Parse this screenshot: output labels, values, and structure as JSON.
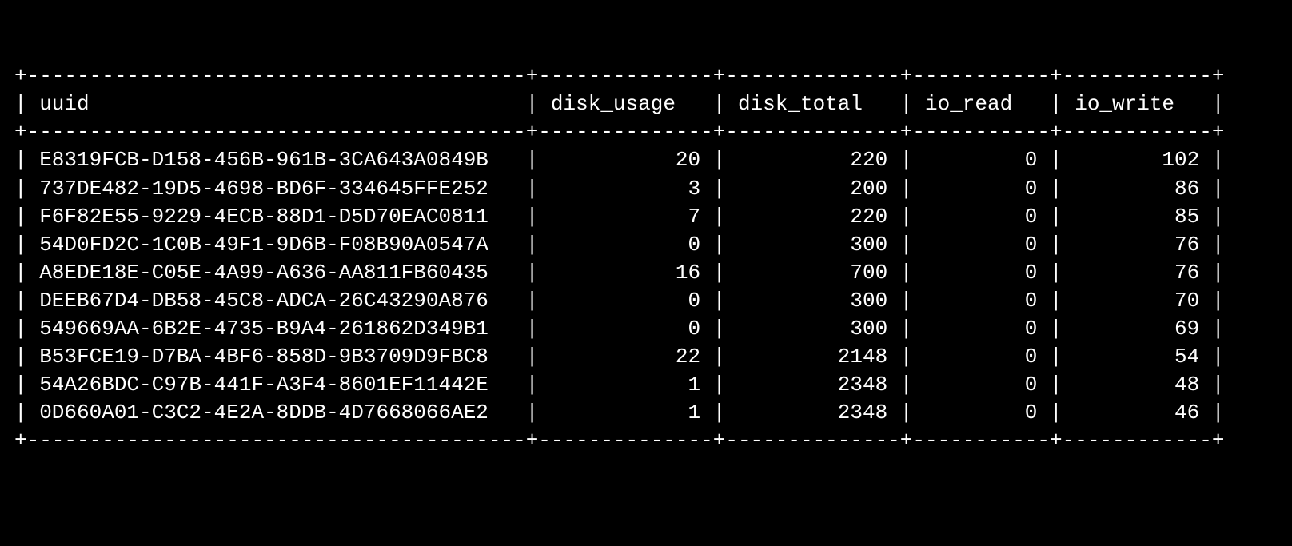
{
  "table": {
    "columns": [
      {
        "name": "uuid",
        "width": 38,
        "align": "left"
      },
      {
        "name": "disk_usage",
        "width": 12,
        "align": "right"
      },
      {
        "name": "disk_total",
        "width": 12,
        "align": "right"
      },
      {
        "name": "io_read",
        "width": 9,
        "align": "right"
      },
      {
        "name": "io_write",
        "width": 10,
        "align": "right"
      }
    ],
    "rows": [
      {
        "uuid": "E8319FCB-D158-456B-961B-3CA643A0849B",
        "disk_usage": "20",
        "disk_total": "220",
        "io_read": "0",
        "io_write": "102"
      },
      {
        "uuid": "737DE482-19D5-4698-BD6F-334645FFE252",
        "disk_usage": "3",
        "disk_total": "200",
        "io_read": "0",
        "io_write": "86"
      },
      {
        "uuid": "F6F82E55-9229-4ECB-88D1-D5D70EAC0811",
        "disk_usage": "7",
        "disk_total": "220",
        "io_read": "0",
        "io_write": "85"
      },
      {
        "uuid": "54D0FD2C-1C0B-49F1-9D6B-F08B90A0547A",
        "disk_usage": "0",
        "disk_total": "300",
        "io_read": "0",
        "io_write": "76"
      },
      {
        "uuid": "A8EDE18E-C05E-4A99-A636-AA811FB60435",
        "disk_usage": "16",
        "disk_total": "700",
        "io_read": "0",
        "io_write": "76"
      },
      {
        "uuid": "DEEB67D4-DB58-45C8-ADCA-26C43290A876",
        "disk_usage": "0",
        "disk_total": "300",
        "io_read": "0",
        "io_write": "70"
      },
      {
        "uuid": "549669AA-6B2E-4735-B9A4-261862D349B1",
        "disk_usage": "0",
        "disk_total": "300",
        "io_read": "0",
        "io_write": "69"
      },
      {
        "uuid": "B53FCE19-D7BA-4BF6-858D-9B3709D9FBC8",
        "disk_usage": "22",
        "disk_total": "2148",
        "io_read": "0",
        "io_write": "54"
      },
      {
        "uuid": "54A26BDC-C97B-441F-A3F4-8601EF11442E",
        "disk_usage": "1",
        "disk_total": "2348",
        "io_read": "0",
        "io_write": "48"
      },
      {
        "uuid": "0D660A01-C3C2-4E2A-8DDB-4D7668066AE2",
        "disk_usage": "1",
        "disk_total": "2348",
        "io_read": "0",
        "io_write": "46"
      }
    ]
  }
}
